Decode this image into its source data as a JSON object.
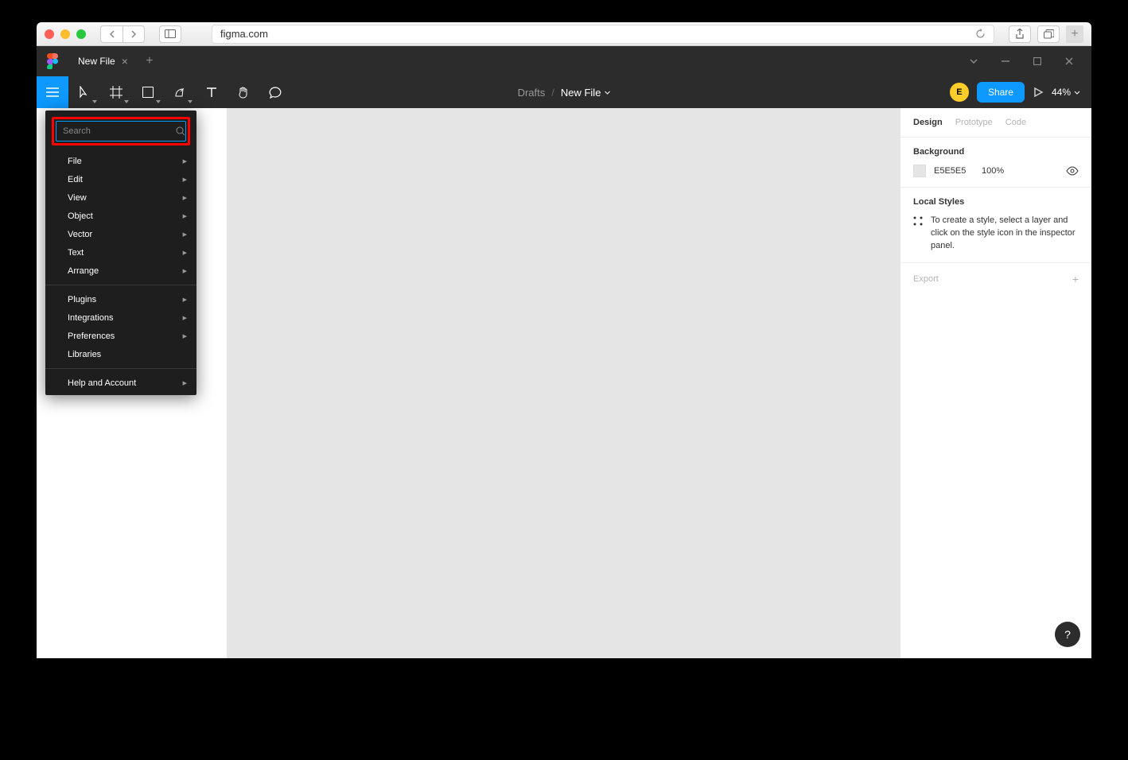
{
  "browser": {
    "url": "figma.com"
  },
  "tab": {
    "title": "New File"
  },
  "breadcrumb": {
    "drafts": "Drafts",
    "file": "New File"
  },
  "toolbar": {
    "share_label": "Share",
    "zoom_label": "44%",
    "avatar_initial": "E"
  },
  "dropdown": {
    "search_placeholder": "Search",
    "groups": [
      [
        "File",
        "Edit",
        "View",
        "Object",
        "Vector",
        "Text",
        "Arrange"
      ],
      [
        "Plugins",
        "Integrations",
        "Preferences",
        "Libraries"
      ],
      [
        "Help and Account"
      ]
    ],
    "no_sub": [
      "Libraries"
    ]
  },
  "right_panel": {
    "tabs": {
      "design": "Design",
      "prototype": "Prototype",
      "code": "Code"
    },
    "background": {
      "title": "Background",
      "hex": "E5E5E5",
      "opacity": "100%"
    },
    "local_styles": {
      "title": "Local Styles",
      "hint": "To create a style, select a layer and click on the style icon in the inspector panel."
    },
    "export_label": "Export"
  },
  "help_label": "?"
}
